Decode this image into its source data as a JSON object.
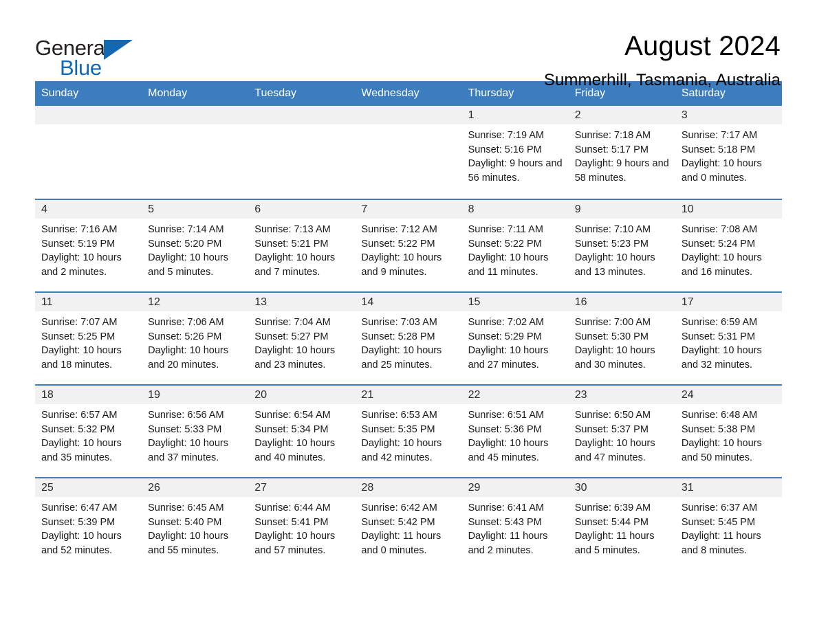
{
  "brand": {
    "line1": "General",
    "line2": "Blue",
    "triangle_color": "#1268b3"
  },
  "header": {
    "month_title": "August 2024",
    "location": "Summerhill, Tasmania, Australia"
  },
  "theme": {
    "header_blue": "#3b7dbf",
    "band_gray": "#f1f1f1",
    "brand_blue": "#1268b3"
  },
  "calendar": {
    "weekdays": [
      "Sunday",
      "Monday",
      "Tuesday",
      "Wednesday",
      "Thursday",
      "Friday",
      "Saturday"
    ],
    "weeks": [
      [
        {
          "day": "",
          "empty": true
        },
        {
          "day": "",
          "empty": true
        },
        {
          "day": "",
          "empty": true
        },
        {
          "day": "",
          "empty": true
        },
        {
          "day": "1",
          "sunrise": "Sunrise: 7:19 AM",
          "sunset": "Sunset: 5:16 PM",
          "daylight": "Daylight: 9 hours and 56 minutes."
        },
        {
          "day": "2",
          "sunrise": "Sunrise: 7:18 AM",
          "sunset": "Sunset: 5:17 PM",
          "daylight": "Daylight: 9 hours and 58 minutes."
        },
        {
          "day": "3",
          "sunrise": "Sunrise: 7:17 AM",
          "sunset": "Sunset: 5:18 PM",
          "daylight": "Daylight: 10 hours and 0 minutes."
        }
      ],
      [
        {
          "day": "4",
          "sunrise": "Sunrise: 7:16 AM",
          "sunset": "Sunset: 5:19 PM",
          "daylight": "Daylight: 10 hours and 2 minutes."
        },
        {
          "day": "5",
          "sunrise": "Sunrise: 7:14 AM",
          "sunset": "Sunset: 5:20 PM",
          "daylight": "Daylight: 10 hours and 5 minutes."
        },
        {
          "day": "6",
          "sunrise": "Sunrise: 7:13 AM",
          "sunset": "Sunset: 5:21 PM",
          "daylight": "Daylight: 10 hours and 7 minutes."
        },
        {
          "day": "7",
          "sunrise": "Sunrise: 7:12 AM",
          "sunset": "Sunset: 5:22 PM",
          "daylight": "Daylight: 10 hours and 9 minutes."
        },
        {
          "day": "8",
          "sunrise": "Sunrise: 7:11 AM",
          "sunset": "Sunset: 5:22 PM",
          "daylight": "Daylight: 10 hours and 11 minutes."
        },
        {
          "day": "9",
          "sunrise": "Sunrise: 7:10 AM",
          "sunset": "Sunset: 5:23 PM",
          "daylight": "Daylight: 10 hours and 13 minutes."
        },
        {
          "day": "10",
          "sunrise": "Sunrise: 7:08 AM",
          "sunset": "Sunset: 5:24 PM",
          "daylight": "Daylight: 10 hours and 16 minutes."
        }
      ],
      [
        {
          "day": "11",
          "sunrise": "Sunrise: 7:07 AM",
          "sunset": "Sunset: 5:25 PM",
          "daylight": "Daylight: 10 hours and 18 minutes."
        },
        {
          "day": "12",
          "sunrise": "Sunrise: 7:06 AM",
          "sunset": "Sunset: 5:26 PM",
          "daylight": "Daylight: 10 hours and 20 minutes."
        },
        {
          "day": "13",
          "sunrise": "Sunrise: 7:04 AM",
          "sunset": "Sunset: 5:27 PM",
          "daylight": "Daylight: 10 hours and 23 minutes."
        },
        {
          "day": "14",
          "sunrise": "Sunrise: 7:03 AM",
          "sunset": "Sunset: 5:28 PM",
          "daylight": "Daylight: 10 hours and 25 minutes."
        },
        {
          "day": "15",
          "sunrise": "Sunrise: 7:02 AM",
          "sunset": "Sunset: 5:29 PM",
          "daylight": "Daylight: 10 hours and 27 minutes."
        },
        {
          "day": "16",
          "sunrise": "Sunrise: 7:00 AM",
          "sunset": "Sunset: 5:30 PM",
          "daylight": "Daylight: 10 hours and 30 minutes."
        },
        {
          "day": "17",
          "sunrise": "Sunrise: 6:59 AM",
          "sunset": "Sunset: 5:31 PM",
          "daylight": "Daylight: 10 hours and 32 minutes."
        }
      ],
      [
        {
          "day": "18",
          "sunrise": "Sunrise: 6:57 AM",
          "sunset": "Sunset: 5:32 PM",
          "daylight": "Daylight: 10 hours and 35 minutes."
        },
        {
          "day": "19",
          "sunrise": "Sunrise: 6:56 AM",
          "sunset": "Sunset: 5:33 PM",
          "daylight": "Daylight: 10 hours and 37 minutes."
        },
        {
          "day": "20",
          "sunrise": "Sunrise: 6:54 AM",
          "sunset": "Sunset: 5:34 PM",
          "daylight": "Daylight: 10 hours and 40 minutes."
        },
        {
          "day": "21",
          "sunrise": "Sunrise: 6:53 AM",
          "sunset": "Sunset: 5:35 PM",
          "daylight": "Daylight: 10 hours and 42 minutes."
        },
        {
          "day": "22",
          "sunrise": "Sunrise: 6:51 AM",
          "sunset": "Sunset: 5:36 PM",
          "daylight": "Daylight: 10 hours and 45 minutes."
        },
        {
          "day": "23",
          "sunrise": "Sunrise: 6:50 AM",
          "sunset": "Sunset: 5:37 PM",
          "daylight": "Daylight: 10 hours and 47 minutes."
        },
        {
          "day": "24",
          "sunrise": "Sunrise: 6:48 AM",
          "sunset": "Sunset: 5:38 PM",
          "daylight": "Daylight: 10 hours and 50 minutes."
        }
      ],
      [
        {
          "day": "25",
          "sunrise": "Sunrise: 6:47 AM",
          "sunset": "Sunset: 5:39 PM",
          "daylight": "Daylight: 10 hours and 52 minutes."
        },
        {
          "day": "26",
          "sunrise": "Sunrise: 6:45 AM",
          "sunset": "Sunset: 5:40 PM",
          "daylight": "Daylight: 10 hours and 55 minutes."
        },
        {
          "day": "27",
          "sunrise": "Sunrise: 6:44 AM",
          "sunset": "Sunset: 5:41 PM",
          "daylight": "Daylight: 10 hours and 57 minutes."
        },
        {
          "day": "28",
          "sunrise": "Sunrise: 6:42 AM",
          "sunset": "Sunset: 5:42 PM",
          "daylight": "Daylight: 11 hours and 0 minutes."
        },
        {
          "day": "29",
          "sunrise": "Sunrise: 6:41 AM",
          "sunset": "Sunset: 5:43 PM",
          "daylight": "Daylight: 11 hours and 2 minutes."
        },
        {
          "day": "30",
          "sunrise": "Sunrise: 6:39 AM",
          "sunset": "Sunset: 5:44 PM",
          "daylight": "Daylight: 11 hours and 5 minutes."
        },
        {
          "day": "31",
          "sunrise": "Sunrise: 6:37 AM",
          "sunset": "Sunset: 5:45 PM",
          "daylight": "Daylight: 11 hours and 8 minutes."
        }
      ]
    ]
  }
}
